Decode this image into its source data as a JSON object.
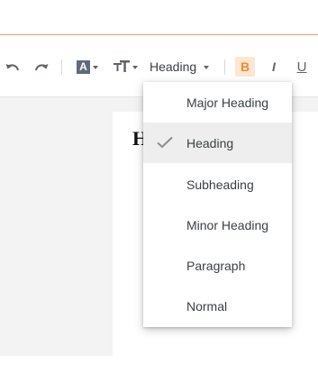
{
  "toolbar": {
    "undo_icon": "undo-icon",
    "redo_icon": "redo-icon",
    "font_color_glyph": "A",
    "font_size_icon": "text-size-icon",
    "heading_select_label": "Heading",
    "bold_label": "B",
    "italic_label": "I",
    "underline_label": "U",
    "accent_color": "#f08c2d"
  },
  "page": {
    "visible_text": "H"
  },
  "heading_menu": {
    "selected": "Heading",
    "items": [
      {
        "label": "Major Heading",
        "selected": false
      },
      {
        "label": "Heading",
        "selected": true
      },
      {
        "label": "Subheading",
        "selected": false
      },
      {
        "label": "Minor Heading",
        "selected": false
      },
      {
        "label": "Paragraph",
        "selected": false
      },
      {
        "label": "Normal",
        "selected": false
      }
    ]
  }
}
